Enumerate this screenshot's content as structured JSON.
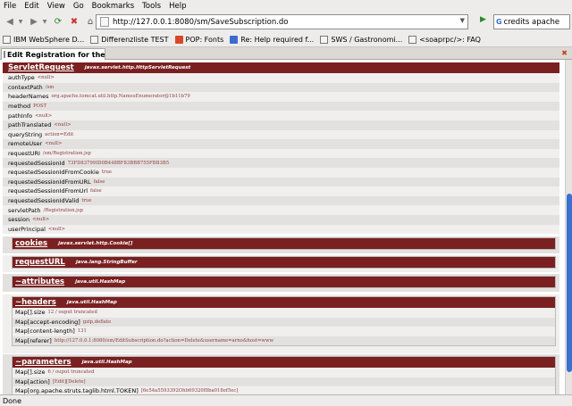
{
  "menu": [
    "File",
    "Edit",
    "View",
    "Go",
    "Bookmarks",
    "Tools",
    "Help"
  ],
  "nav": {
    "url": "http://127.0.0.1:8080/sm/SaveSubscription.do",
    "search_value": "credits apache"
  },
  "bookmarks": [
    {
      "label": "IBM WebSphere D...",
      "icon": "doc"
    },
    {
      "label": "Differenzliste TEST",
      "icon": "doc"
    },
    {
      "label": "POP: Fonts",
      "icon": "red"
    },
    {
      "label": "Re: Help required f...",
      "icon": "blue"
    },
    {
      "label": "SWS / Gastronomi...",
      "icon": "doc"
    },
    {
      "label": "<soaprpc/>: FAQ",
      "icon": "doc"
    }
  ],
  "tab": {
    "title": "Edit Registration for the..."
  },
  "servlet_request": {
    "name": "ServletRequest",
    "type": "javax.servlet.http.HttpServletRequest",
    "rows": [
      {
        "k": "authType",
        "v": "<null>"
      },
      {
        "k": "contextPath",
        "v": "/sm"
      },
      {
        "k": "headerNames",
        "v": "org.apache.tomcat.util.http.NamesEnumerator@1b11b79"
      },
      {
        "k": "method",
        "v": "POST"
      },
      {
        "k": "pathInfo",
        "v": "<null>"
      },
      {
        "k": "pathTranslated",
        "v": "<null>"
      },
      {
        "k": "queryString",
        "v": "action=Edit"
      },
      {
        "k": "remoteUser",
        "v": "<null>"
      },
      {
        "k": "requestURI",
        "v": "/sm/Registration.jsp"
      },
      {
        "k": "requestedSessionId",
        "v": "73FD83799ID0B448BF83BBB755FBB3B5"
      },
      {
        "k": "requestedSessionIdFromCookie",
        "v": "true"
      },
      {
        "k": "requestedSessionIdFromURL",
        "v": "false"
      },
      {
        "k": "requestedSessionIdFromUrl",
        "v": "false"
      },
      {
        "k": "requestedSessionIdValid",
        "v": "true"
      },
      {
        "k": "servletPath",
        "v": "/Registration.jsp"
      },
      {
        "k": "session",
        "v": "<null>"
      },
      {
        "k": "userPrincipal",
        "v": "<null>"
      }
    ]
  },
  "cookies": {
    "name": "cookies",
    "type": "javax.servlet.http.Cookie[]"
  },
  "request_url": {
    "name": "requestURL",
    "type": "java.lang.StringBuffer"
  },
  "attributes": {
    "name": "~attributes",
    "type": "java.util.HashMap"
  },
  "headers": {
    "name": "~headers",
    "type": "java.util.HashMap",
    "rows": [
      {
        "k": "Map[].size",
        "v": "12 / ouput truncated"
      },
      {
        "k": "Map[accept-encoding]",
        "v": "gzip,deflate"
      },
      {
        "k": "Map[content-length]",
        "v": "131"
      },
      {
        "k": "Map[referer]",
        "v": "http://127.0.0.1:8080/sm/EditSubscription.do?action=Delete&username=arno&host=www"
      }
    ]
  },
  "parameters": {
    "name": "~parameters",
    "type": "java.util.HashMap",
    "rows": [
      {
        "k": "Map[].size",
        "v": "6 / ouput truncated"
      },
      {
        "k": "Map[action]",
        "v": "[Edit][Delete]"
      },
      {
        "k": "Map[org.apache.struts.taglib.html.TOKEN]",
        "v": "[6e54a5593392Ohb69320f8ba018ef5ec]"
      }
    ]
  },
  "status": "Done"
}
